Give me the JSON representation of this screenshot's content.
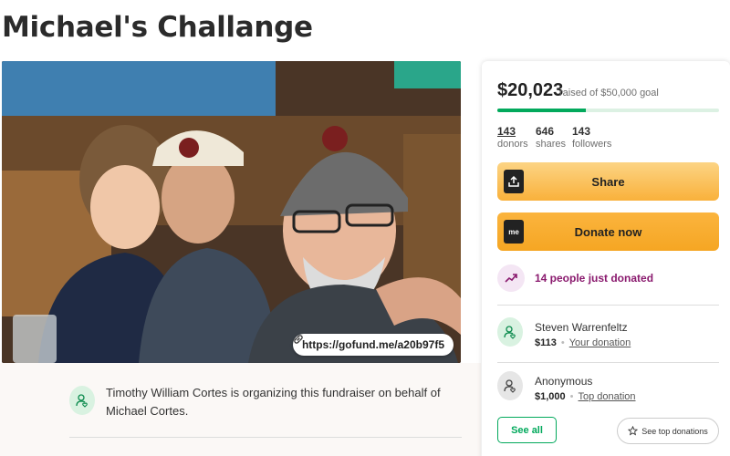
{
  "page": {
    "title": "Michael's Challange"
  },
  "hero": {
    "share_link": "https://gofund.me/a20b97f5"
  },
  "organizer": {
    "text": "Timothy William Cortes is organizing this fundraiser on behalf of Michael Cortes."
  },
  "donation_panel": {
    "raised": "$20,023",
    "goal_text": "raised of $50,000 goal",
    "progress_fraction": 0.4,
    "stats": [
      {
        "value": "143",
        "label": "donors"
      },
      {
        "value": "646",
        "label": "shares"
      },
      {
        "value": "143",
        "label": "followers"
      }
    ],
    "share_label": "Share",
    "donate_label": "Donate now",
    "donate_icon_text": "me",
    "recent_text": "14 people just donated",
    "donations": [
      {
        "name": "Steven Warrenfeltz",
        "amount": "$113",
        "tag": "Your donation"
      },
      {
        "name": "Anonymous",
        "amount": "$1,000",
        "tag": "Top donation"
      }
    ],
    "see_all_label": "See all",
    "see_top_label": "See top donations"
  },
  "colors": {
    "brand_green": "#02a95c",
    "button_yellow": "#f9b13b",
    "trending_purple": "#8a1a6e"
  },
  "icons": [
    "share-icon",
    "gofundme-icon",
    "trending-icon",
    "donor-heart-icon",
    "star-icon",
    "link-icon"
  ]
}
